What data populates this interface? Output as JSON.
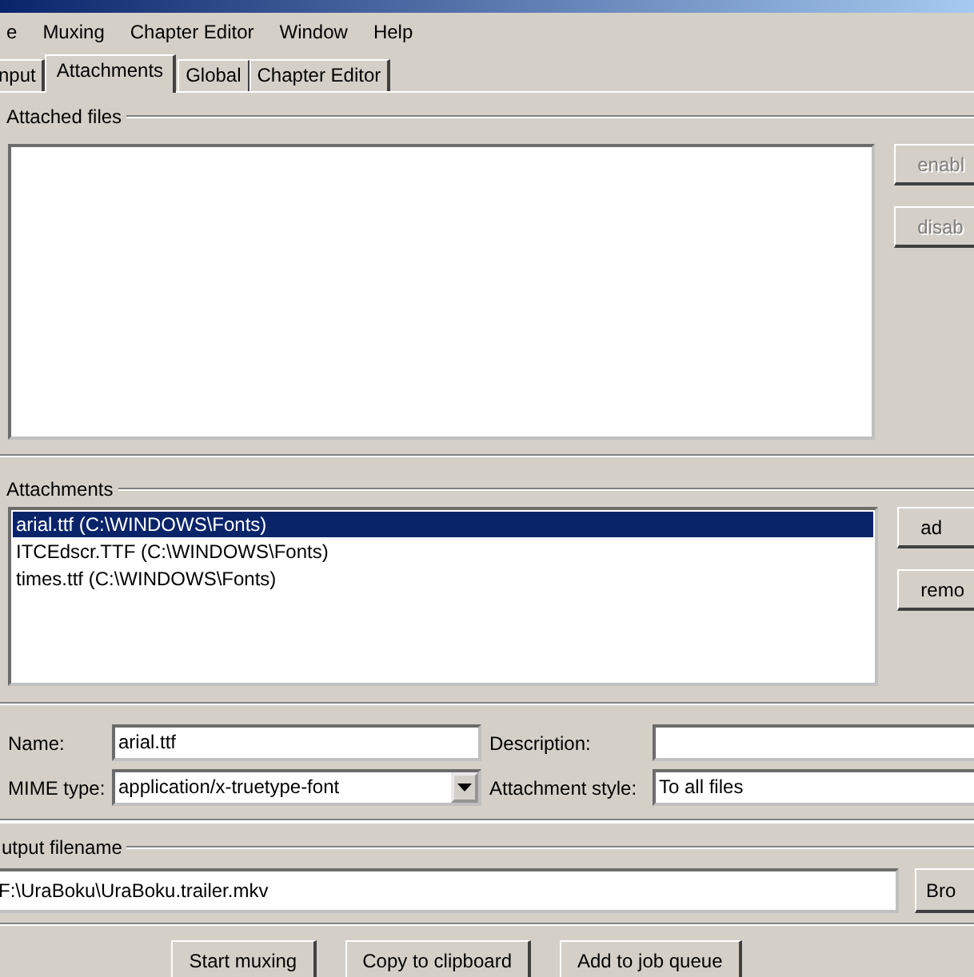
{
  "menu": [
    {
      "label": "e"
    },
    {
      "label": "Muxing"
    },
    {
      "label": "Chapter Editor"
    },
    {
      "label": "Window"
    },
    {
      "label": "Help"
    }
  ],
  "tabs": [
    {
      "label": "nput",
      "selected": false
    },
    {
      "label": "Attachments",
      "selected": true
    },
    {
      "label": "Global",
      "selected": false
    },
    {
      "label": "Chapter Editor",
      "selected": false
    }
  ],
  "attached_files": {
    "label": "Attached files",
    "buttons": [
      {
        "label": "enabl",
        "disabled": true
      },
      {
        "label": "disab",
        "disabled": true
      }
    ]
  },
  "attachments": {
    "label": "Attachments",
    "items": [
      {
        "text": "arial.ttf (C:\\WINDOWS\\Fonts)",
        "selected": true
      },
      {
        "text": "ITCEdscr.TTF (C:\\WINDOWS\\Fonts)",
        "selected": false
      },
      {
        "text": "times.ttf (C:\\WINDOWS\\Fonts)",
        "selected": false
      }
    ],
    "buttons": [
      {
        "label": "ad",
        "disabled": false
      },
      {
        "label": "remo",
        "disabled": false
      }
    ]
  },
  "details": {
    "name_label": "Name:",
    "name": "arial.ttf",
    "description_label": "Description:",
    "mime_label": "MIME type:",
    "mime_type": "application/x-truetype-font",
    "style_label": "Attachment style:",
    "style": "To all files"
  },
  "output": {
    "label": "utput filename",
    "filename": "F:\\UraBoku\\UraBoku.trailer.mkv",
    "browse_button": "Bro"
  },
  "actions": [
    {
      "label": "Start muxing"
    },
    {
      "label": "Copy to clipboard"
    },
    {
      "label": "Add to job queue"
    }
  ]
}
